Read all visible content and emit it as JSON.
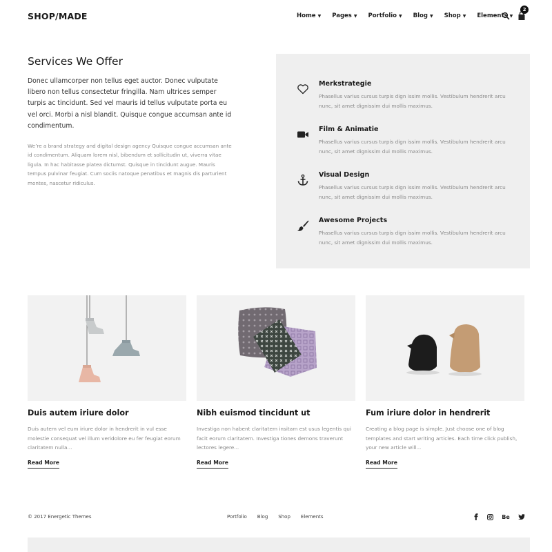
{
  "logo": "SHOP/MADE",
  "nav": {
    "items": [
      {
        "label": "Home"
      },
      {
        "label": "Pages"
      },
      {
        "label": "Portfolio"
      },
      {
        "label": "Blog"
      },
      {
        "label": "Shop"
      },
      {
        "label": "Elements"
      }
    ],
    "cart_count": "2"
  },
  "intro": {
    "title": "Services We Offer",
    "lead": "Donec ullamcorper non tellus eget auctor. Donec vulputate libero non tellus consectetur fringilla. Nam ultrices semper turpis ac tincidunt. Sed vel mauris id tellus vulputate porta eu vel orci. Morbi a nisl blandit. Quisque congue accumsan ante id condimentum.",
    "body": "We’re a brand strategy and digital design agency Quisque congue accumsan ante id condimentum. Aliquam lorem nisl, bibendum et sollicitudin ut, viverra vitae ligula. In hac habitasse platea dictumst. Quisque in tincidunt augue. Mauris tempus pulvinar feugiat. Cum sociis natoque penatibus et magnis dis parturient montes, nascetur ridiculus."
  },
  "services": [
    {
      "icon": "heart-icon",
      "title": "Merkstrategie",
      "text": "Phasellus varius cursus turpis dign issim mollis. Vestibulum hendrerit arcu nunc, sit amet dignissim dui mollis maximus."
    },
    {
      "icon": "video-camera-icon",
      "title": "Film & Animatie",
      "text": "Phasellus varius cursus turpis dign issim mollis. Vestibulum hendrerit arcu nunc, sit amet dignissim dui mollis maximus."
    },
    {
      "icon": "anchor-icon",
      "title": "Visual Design",
      "text": "Phasellus varius cursus turpis dign issim mollis. Vestibulum hendrerit arcu nunc, sit amet dignissim dui mollis maximus."
    },
    {
      "icon": "paintbrush-icon",
      "title": "Awesome Projects",
      "text": "Phasellus varius cursus turpis dign issim mollis. Vestibulum hendrerit arcu nunc, sit amet dignissim dui mollis maximus."
    }
  ],
  "cards": [
    {
      "title": "Duis autem iriure dolor",
      "text": "Duis autem vel eum iriure dolor in hendrerit in vul esse molestie consequat vel illum veridolore eu fer feugiat eorum claritatem nulla...",
      "link": "Read More"
    },
    {
      "title": "Nibh euismod tincidunt ut",
      "text": "Investiga non habent claritatem insitam est usus legentis qui facit eorum claritatem. Investiga tiones demons traverunt lectores legere...",
      "link": "Read More"
    },
    {
      "title": "Fum iriure dolor in hendrerit",
      "text": "Creating a blog page is simple. Just choose one of blog templates and start writing articles. Each time click publish, your new article will...",
      "link": "Read More"
    }
  ],
  "footer": {
    "copyright": "© 2017 Energetic Themes",
    "links": [
      "Portfolio",
      "Blog",
      "Shop",
      "Elements"
    ],
    "social": [
      "facebook-icon",
      "instagram-icon",
      "behance-icon",
      "twitter-icon"
    ],
    "behance_label": "Be"
  },
  "colors": {
    "panel": "#efefef",
    "text": "#222222",
    "muted": "#888888"
  }
}
